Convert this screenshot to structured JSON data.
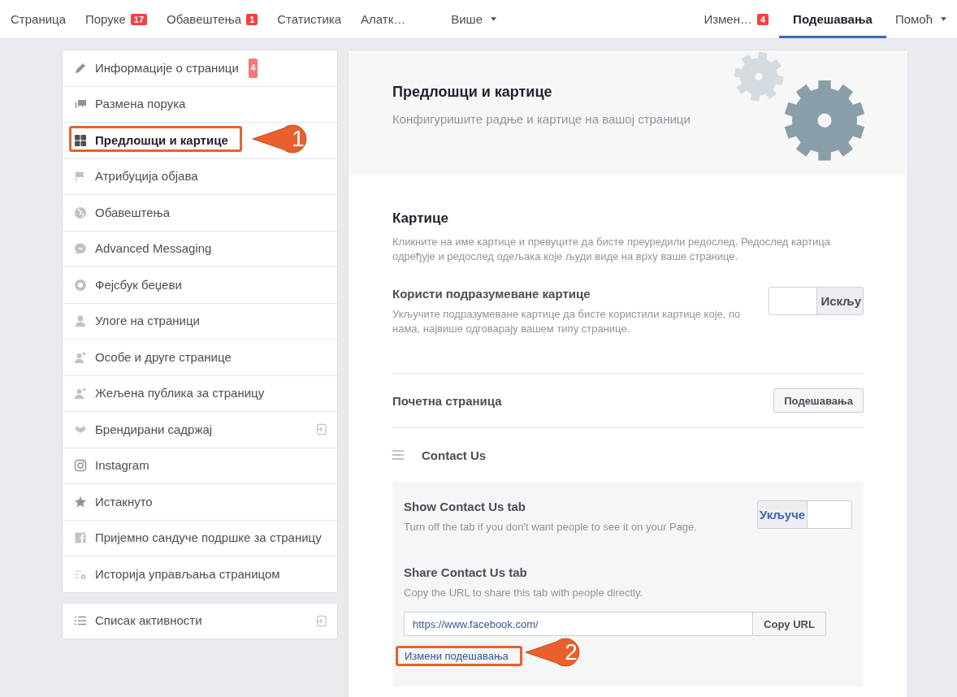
{
  "nav": {
    "left": [
      {
        "label": "Страница",
        "selected": false
      },
      {
        "label": "Поруке",
        "badge": "17",
        "selected": false
      },
      {
        "label": "Обавештења",
        "badge": "1",
        "selected": false
      },
      {
        "label": "Статистика",
        "selected": false
      },
      {
        "label": "Алатк…",
        "selected": false
      },
      {
        "label": "Више",
        "dropdown": true,
        "selected": false
      }
    ],
    "right": [
      {
        "label": "Измен…",
        "badge": "4",
        "selected": false
      },
      {
        "label": "Подешавања",
        "selected": true
      },
      {
        "label": "Помоћ",
        "dropdown": true,
        "selected": false
      }
    ]
  },
  "sidebar": {
    "items": [
      {
        "label": "Информације о страници",
        "badge": "4",
        "selected": false
      },
      {
        "label": "Размена порука",
        "selected": false
      },
      {
        "label": "Предлошци и картице",
        "selected": true,
        "callout": "1"
      },
      {
        "label": "Атрибуција објава",
        "selected": false
      },
      {
        "label": "Обавештења",
        "selected": false
      },
      {
        "label": "Advanced Messaging",
        "selected": false
      },
      {
        "label": "Фејсбук беџеви",
        "selected": false
      },
      {
        "label": "Улоге на страници",
        "selected": false
      },
      {
        "label": "Особе и друге странице",
        "selected": false
      },
      {
        "label": "Жељена публика за страницу",
        "selected": false
      },
      {
        "label": "Брендирани садржај",
        "external": true,
        "selected": false
      },
      {
        "label": "Instagram",
        "selected": false
      },
      {
        "label": "Истакнуто",
        "selected": false
      },
      {
        "label": "Пријемно сандуче подршке за страницу",
        "selected": false
      },
      {
        "label": "Историја управљања страницом",
        "selected": false
      }
    ],
    "extra": [
      {
        "label": "Списак активности",
        "external": true,
        "selected": false
      }
    ]
  },
  "header": {
    "title": "Предлошци и картице",
    "subtitle": "Конфигуришите радње и картице на вашој страници"
  },
  "tabs_section": {
    "title": "Картице",
    "description": "Кликните на име картице и превуците да бисте преуредили редослед. Редослед картица одређује и редослед одељака које људи виде на врху ваше странице.",
    "default_tabs": {
      "title": "Користи подразумеване картице",
      "description": "Укључите подразумеване картице да бисте користили картице које, по нама, највише одговарају вашем типу странице.",
      "toggle": {
        "label": "Искљу",
        "on": false
      }
    },
    "home": {
      "title": "Почетна страница",
      "button": "Подешавања"
    },
    "contact": {
      "title": "Contact Us",
      "show": {
        "title": "Show Contact Us tab",
        "description": "Turn off the tab if you don't want people to see it on your Page.",
        "toggle": {
          "label": "Укључе",
          "on": true
        }
      },
      "share": {
        "title": "Share Contact Us tab",
        "description": "Copy the URL to share this tab with people directly.",
        "url": "https://www.facebook.com/",
        "button": "Copy URL"
      },
      "link": {
        "label": "Измени подешавања",
        "callout": "2"
      }
    }
  }
}
